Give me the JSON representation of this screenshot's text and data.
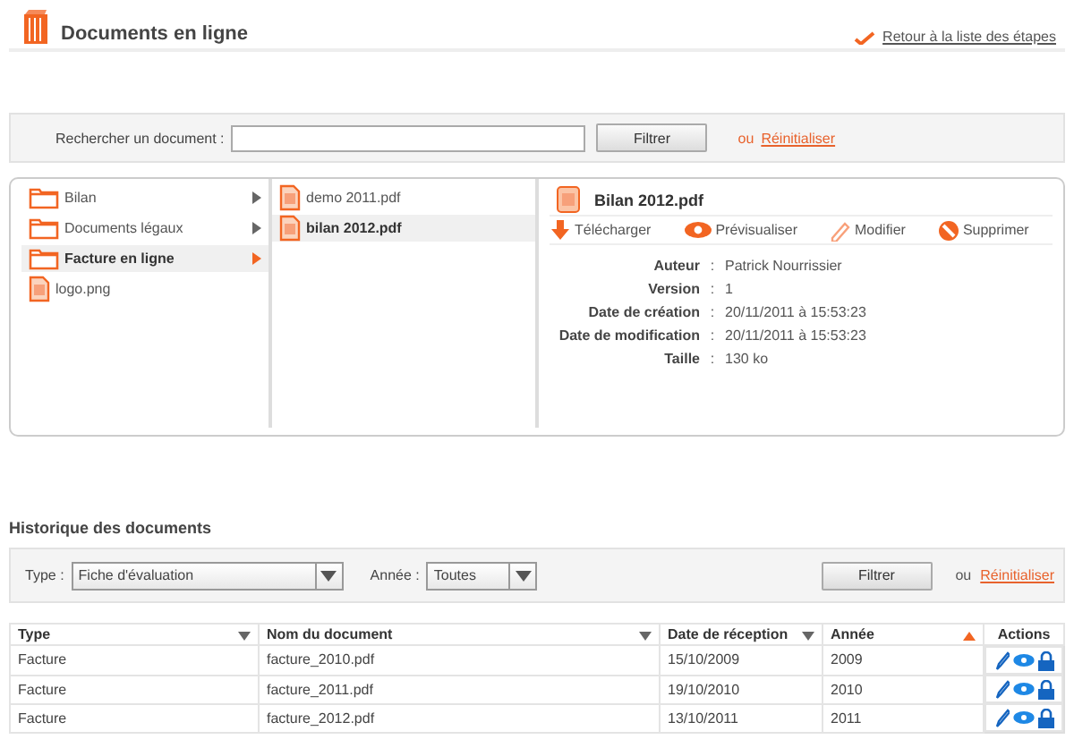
{
  "header": {
    "title": "Documents en ligne",
    "back_link": "Retour à la liste des étapes"
  },
  "search": {
    "label": "Rechercher un document :",
    "button": "Filtrer",
    "or": "ou",
    "reset": "Réinitialiser"
  },
  "browser": {
    "folders": [
      {
        "kind": "folder",
        "label": "Bilan",
        "selected": false
      },
      {
        "kind": "folder",
        "label": "Documents légaux",
        "selected": false
      },
      {
        "kind": "folder",
        "label": "Facture en ligne",
        "selected": true
      },
      {
        "kind": "file",
        "label": "logo.png",
        "selected": false
      }
    ],
    "files": [
      {
        "label": "demo 2011.pdf",
        "selected": false
      },
      {
        "label": "bilan 2012.pdf",
        "selected": true
      }
    ],
    "detail": {
      "title": "Bilan 2012.pdf",
      "actions": [
        {
          "kind": "download",
          "label": "Télécharger"
        },
        {
          "kind": "preview",
          "label": "Prévisualiser"
        },
        {
          "kind": "edit",
          "label": "Modifier"
        },
        {
          "kind": "delete",
          "label": "Supprimer"
        }
      ],
      "properties": [
        {
          "label": "Auteur",
          "separator": ":",
          "value": "Patrick Nourrissier"
        },
        {
          "label": "Version",
          "separator": ":",
          "value": "1"
        },
        {
          "label": "Date de création",
          "separator": ":",
          "value": "20/11/2011 à 15:53:23"
        },
        {
          "label": "Date de modification",
          "separator": ":",
          "value": "20/11/2011 à 15:53:23"
        },
        {
          "label": "Taille",
          "separator": ":",
          "value": "130 ko"
        }
      ]
    }
  },
  "history": {
    "title": "Historique des documents",
    "filters": {
      "type_label": "Type :",
      "type_value": "Fiche d'évaluation",
      "year_label": "Année :",
      "year_value": "Toutes",
      "button": "Filtrer",
      "or": "ou",
      "reset": "Réinitialiser"
    },
    "columns": [
      {
        "label": "Type",
        "sortable": true,
        "sorted": false
      },
      {
        "label": "Nom du document",
        "sortable": true,
        "sorted": false
      },
      {
        "label": "Date de réception",
        "sortable": true,
        "sorted": false
      },
      {
        "label": "Année",
        "sortable": true,
        "sorted": true
      },
      {
        "label": "Actions",
        "sortable": false
      }
    ],
    "rows": [
      [
        "Facture",
        "facture_2010.pdf",
        "15/10/2009",
        "2009"
      ],
      [
        "Facture",
        "facture_2011.pdf",
        "19/10/2010",
        "2010"
      ],
      [
        "Facture",
        "facture_2012.pdf",
        "13/10/2011",
        "2011"
      ]
    ]
  }
}
